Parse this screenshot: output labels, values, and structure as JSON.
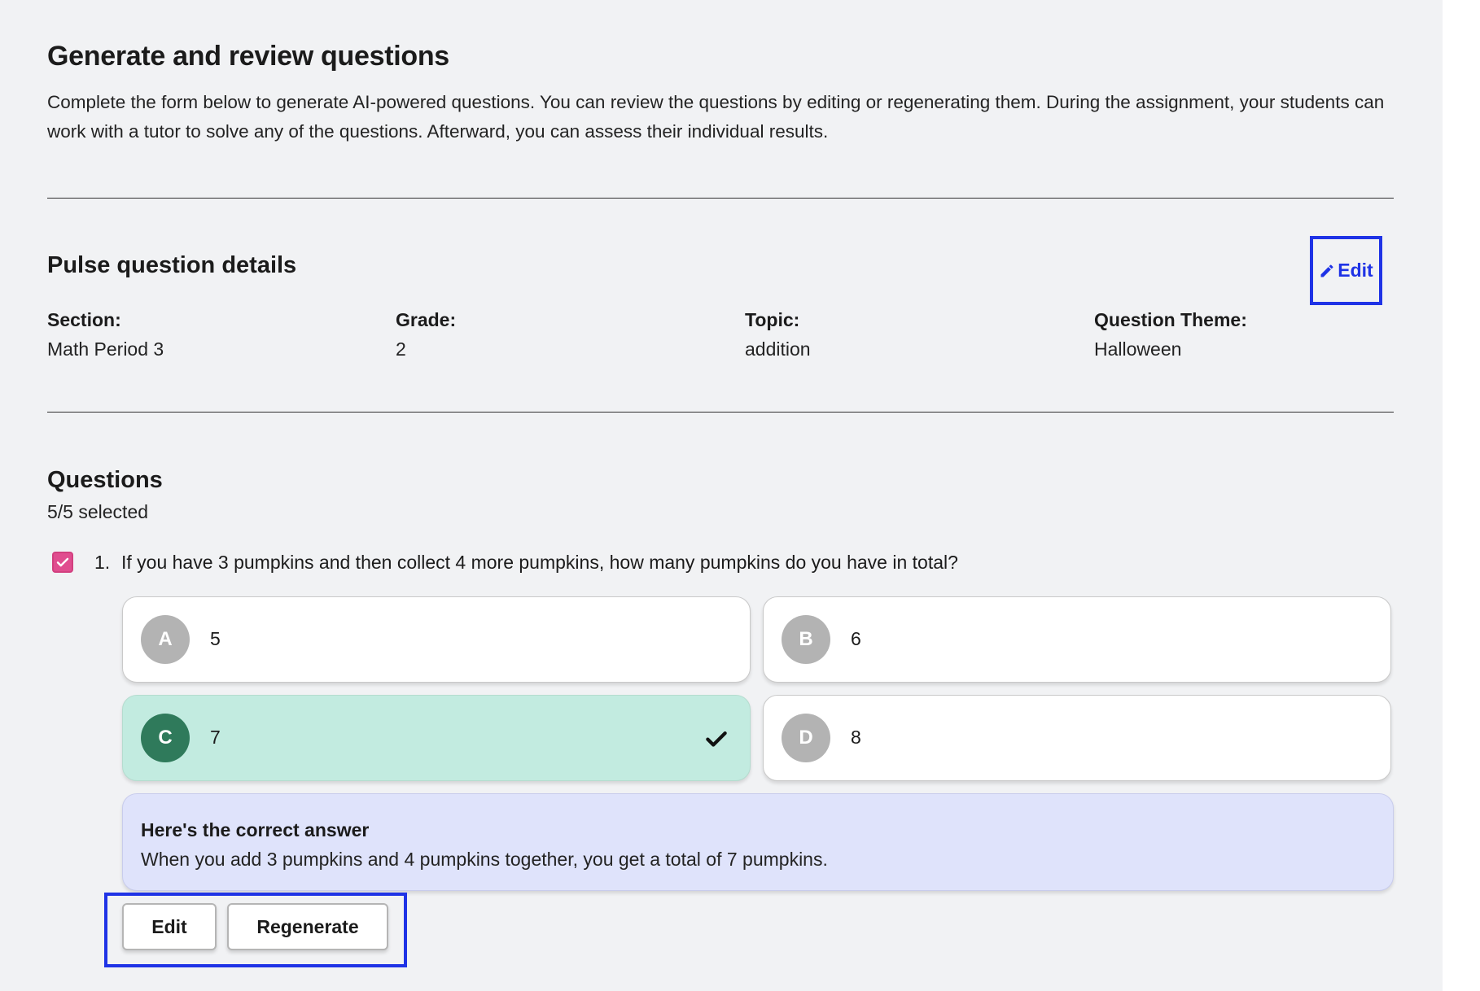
{
  "header": {
    "title": "Generate and review questions",
    "intro": "Complete the form below to generate AI-powered questions. You can review the questions by editing or regenerating them. During the assignment, your students can work with a tutor to solve any of the questions. Afterward, you can assess their individual results."
  },
  "details": {
    "title": "Pulse question details",
    "edit_label": "Edit",
    "fields": [
      {
        "label": "Section:",
        "value": "Math Period 3"
      },
      {
        "label": "Grade:",
        "value": "2"
      },
      {
        "label": "Topic:",
        "value": "addition"
      },
      {
        "label": "Question Theme:",
        "value": "Halloween"
      }
    ]
  },
  "questions": {
    "title": "Questions",
    "selected_count": "5/5 selected",
    "items": [
      {
        "number": "1.",
        "text": "If you have 3 pumpkins and then collect 4 more pumpkins, how many pumpkins do you have in total?",
        "checked": true,
        "choices": [
          {
            "letter": "A",
            "text": "5"
          },
          {
            "letter": "B",
            "text": "6"
          },
          {
            "letter": "C",
            "text": "7",
            "correct": true
          },
          {
            "letter": "D",
            "text": "8"
          }
        ],
        "explanation_title": "Here's the correct answer",
        "explanation_text": "When you add 3 pumpkins and 4 pumpkins together, you get a total of 7 pumpkins.",
        "edit_label": "Edit",
        "regenerate_label": "Regenerate"
      }
    ]
  },
  "colors": {
    "highlight": "#1f33e6",
    "checkbox": "#e04d8f",
    "correct_bg": "#c2ebe0",
    "correct_badge": "#2f7a5b",
    "explanation_bg": "#dfe3fb"
  }
}
